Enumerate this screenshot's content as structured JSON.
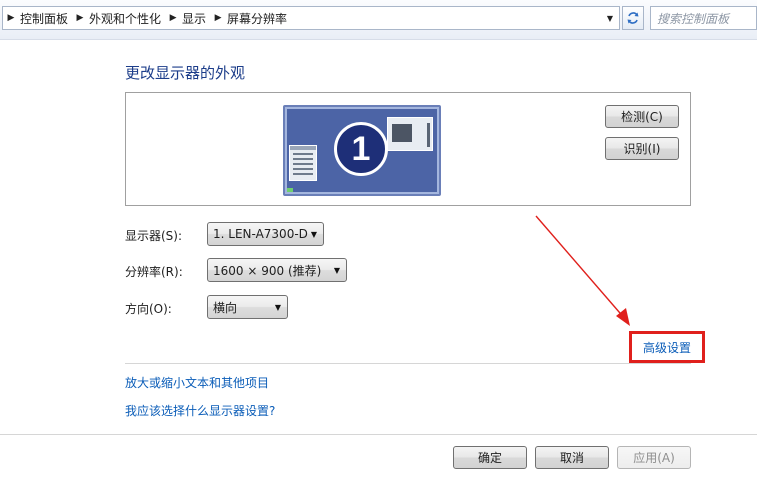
{
  "address_bar": {
    "breadcrumbs": [
      "控制面板",
      "外观和个性化",
      "显示",
      "屏幕分辨率"
    ],
    "search_placeholder": "搜索控制面板"
  },
  "main": {
    "title": "更改显示器的外观",
    "monitor_number": "1",
    "detect_label": "检测(C)",
    "identify_label": "识别(I)",
    "display_label": "显示器(S):",
    "display_value": "1. LEN-A7300-D",
    "resolution_label": "分辨率(R):",
    "resolution_value": "1600 × 900 (推荐)",
    "orientation_label": "方向(O):",
    "orientation_value": "横向",
    "advanced_link": "高级设置",
    "link_text_size": "放大或缩小文本和其他项目",
    "link_which_settings": "我应该选择什么显示器设置?"
  },
  "footer": {
    "ok_label": "确定",
    "cancel_label": "取消",
    "apply_label": "应用(A)"
  },
  "colors": {
    "link": "#0b5db8",
    "title": "#1c3d8a",
    "highlight": "#e0201c"
  },
  "icons": [
    "chevron-right-icon",
    "chevron-down-icon",
    "refresh-icon",
    "monitor-icon",
    "arrow-annotation-icon"
  ]
}
